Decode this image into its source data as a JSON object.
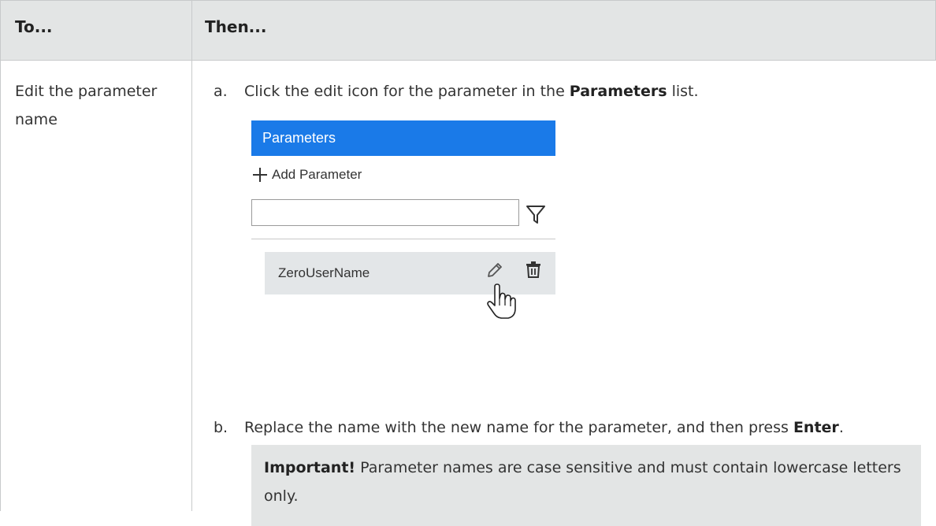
{
  "table": {
    "headers": {
      "to": "To...",
      "then": "Then..."
    },
    "row": {
      "task": "Edit the parameter name",
      "steps": [
        {
          "marker": "a.",
          "text_before": "Click the edit icon for the parameter in the ",
          "bold": "Parameters",
          "text_after": " list."
        },
        {
          "marker": "b.",
          "text_before": "Replace the name with the new name for the parameter, and then press ",
          "bold": "Enter",
          "text_after": "."
        }
      ],
      "note": {
        "label": "Important!",
        "text": " Parameter names are case sensitive and must contain lowercase letters only."
      }
    }
  },
  "panel": {
    "title": "Parameters",
    "add_label": "Add Parameter",
    "filter_value": "",
    "parameter_name": "ZeroUserName",
    "header_color": "#1a7ae8",
    "icons": [
      "plus-icon",
      "filter-icon",
      "pencil-icon",
      "trash-icon",
      "hand-cursor-icon"
    ]
  }
}
